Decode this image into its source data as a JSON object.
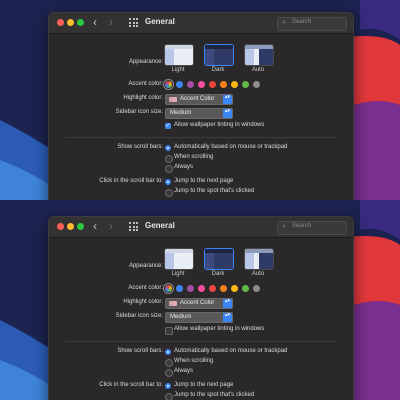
{
  "window": {
    "title": "General"
  },
  "search": {
    "placeholder": "Search"
  },
  "appearance": {
    "label": "Appearance:",
    "options": [
      {
        "name": "Light",
        "selected": false
      },
      {
        "name": "Dark",
        "selected": true
      },
      {
        "name": "Auto",
        "selected": false
      }
    ]
  },
  "accent": {
    "label": "Accent color:",
    "colors": [
      "#8e5ec4",
      "#3b86f7",
      "#a550a7",
      "#f74f9e",
      "#e9473d",
      "#f7821b",
      "#fdb913",
      "#62ba46",
      "#8c8c8c"
    ]
  },
  "highlight": {
    "label": "Highlight color:",
    "value": "Accent Color"
  },
  "sidebar_icon": {
    "label": "Sidebar icon size:",
    "value": "Medium"
  },
  "wallpaper_tinting": {
    "top": {
      "label": "Allow wallpaper tinting in windows",
      "checked": true
    },
    "bottom": {
      "label": "Allow wallpaper tinting in windows",
      "checked": false
    }
  },
  "scroll_bars": {
    "label": "Show scroll bars:",
    "options": [
      "Automatically based on mouse or trackpad",
      "When scrolling",
      "Always"
    ],
    "selected_index": 0
  },
  "click_scroll": {
    "label": "Click in the scroll bar to:",
    "options": [
      "Jump to the next page",
      "Jump to the spot that's clicked"
    ],
    "selected_index": 0
  },
  "icons": {
    "back": "‹",
    "forward": "›",
    "search": "⌕",
    "popup_arrows": "▴▾"
  },
  "colors": {
    "accent": "#3b86f7",
    "window_bg": "#2a2829",
    "close": "#fe5f57",
    "minimize": "#febc2e",
    "maximize": "#28c840"
  }
}
